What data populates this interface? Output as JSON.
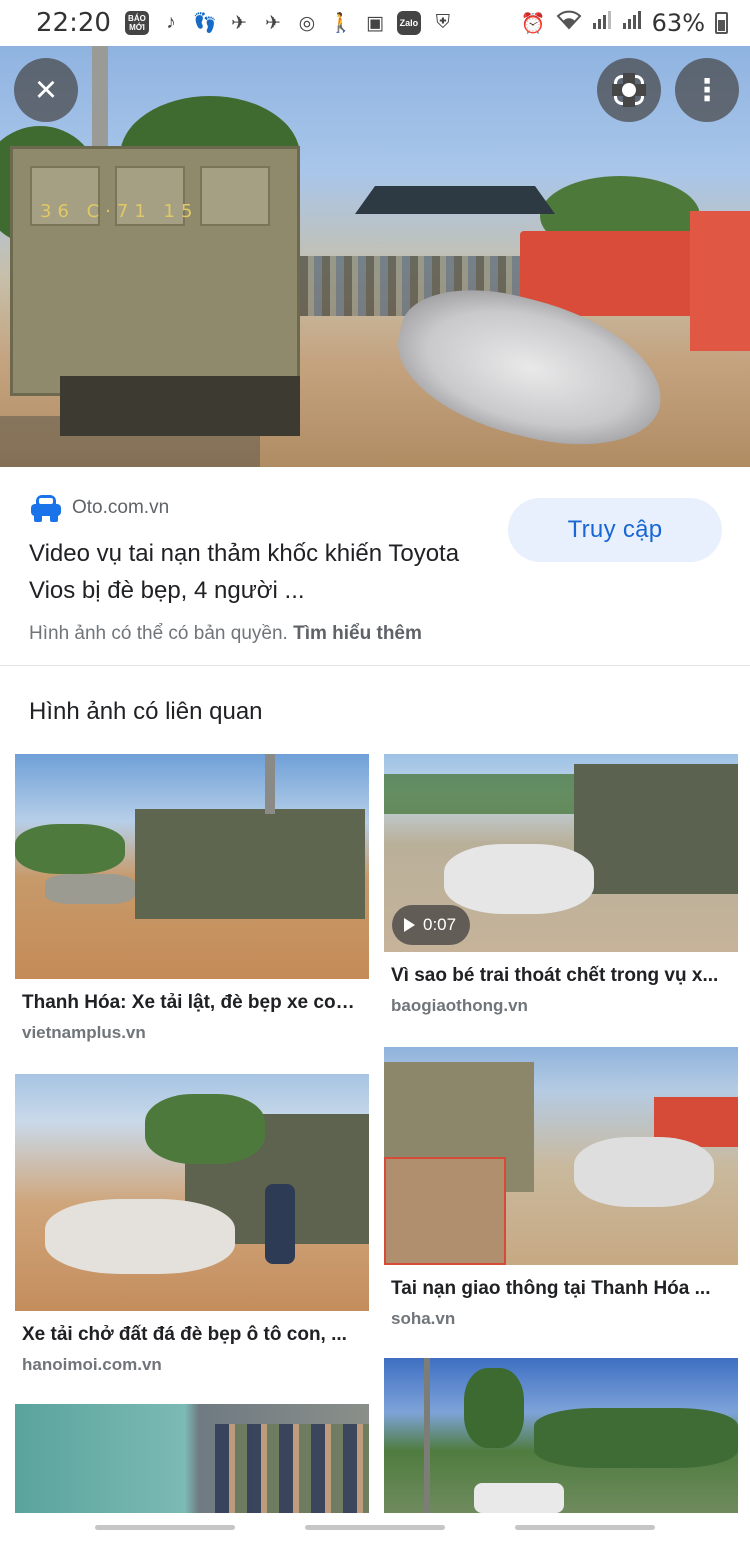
{
  "status_bar": {
    "time": "22:20",
    "left_icons": [
      "bao-moi-icon",
      "tiktok-icon",
      "footprint-icon",
      "airplane-icon",
      "airplane-icon",
      "instagram-icon",
      "walk-icon",
      "gallery-icon",
      "zalo-icon",
      "shield-icon"
    ],
    "bao_moi_label": "BÁO MỚI",
    "zalo_label": "Zalo",
    "right_icons": [
      "alarm-icon",
      "wifi-icon",
      "signal-icon",
      "signal-icon",
      "battery-icon"
    ],
    "battery": "63%"
  },
  "hero": {
    "truck_plate": "36 C·71 15",
    "buttons": {
      "close": "×",
      "more": "⋮"
    }
  },
  "source": {
    "site": "Oto.com.vn",
    "title": "Video vụ tai nạn thảm khốc khiến Toyota Vios bị đè bẹp, 4 người ...",
    "visit_label": "Truy cập",
    "copyright_text": "Hình ảnh có thể có bản quyền.",
    "learn_more": "Tìm hiểu thêm"
  },
  "related": {
    "heading": "Hình ảnh có liên quan",
    "items": [
      {
        "title": "Thanh Hóa: Xe tải lật, đè bẹp xe con...",
        "source": "vietnamplus.vn"
      },
      {
        "title": "Vì sao bé trai thoát chết trong vụ x...",
        "source": "baogiaothong.vn",
        "video_duration": "0:07"
      },
      {
        "title": "Xe tải chở đất đá đè bẹp ô tô con, ...",
        "source": "hanoimoi.com.vn"
      },
      {
        "title": "Tai nạn giao thông tại Thanh Hóa ...",
        "source": "soha.vn"
      }
    ]
  },
  "colors": {
    "accent": "#1a73e8",
    "visit_button_bg": "#e8f0fe",
    "visit_button_text": "#1967d2",
    "text_primary": "#202124",
    "text_secondary": "#70757a"
  }
}
